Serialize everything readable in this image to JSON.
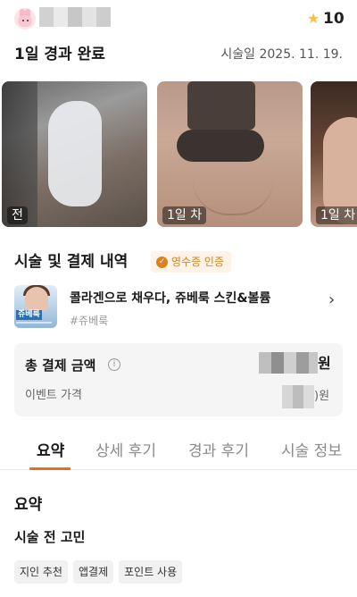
{
  "header": {
    "star_icon": "star-icon",
    "star_count": "10",
    "star_color": "#f6c23e"
  },
  "result": {
    "title": "1일 경과 완료",
    "date": "시술일 2025. 11. 19."
  },
  "photos": [
    {
      "label": "전"
    },
    {
      "label": "1일 차"
    },
    {
      "label": "1일 차"
    }
  ],
  "treatment": {
    "title": "시술 및 결제 내역",
    "badge": "영수증 인증",
    "badge_color": "#d9821f",
    "product": {
      "thumb_tag": "쥬베룩",
      "name": "콜라겐으로 채우다, 쥬베룩 스킨&볼륨",
      "tag": "#쥬베룩"
    }
  },
  "payment": {
    "total_label": "총 결제 금액",
    "total_unit": "원",
    "event_label": "이벤트 가격",
    "event_unit": ")원"
  },
  "tabs": [
    {
      "label": "요약",
      "active": true
    },
    {
      "label": "상세 후기",
      "active": false
    },
    {
      "label": "경과 후기",
      "active": false
    },
    {
      "label": "시술 정보",
      "active": false
    }
  ],
  "accent_color": "#ee6a1f",
  "summary": {
    "title": "요약",
    "worry_title": "시술 전 고민",
    "chips": [
      "지인 추천",
      "앱결제",
      "포인트 사용"
    ]
  }
}
